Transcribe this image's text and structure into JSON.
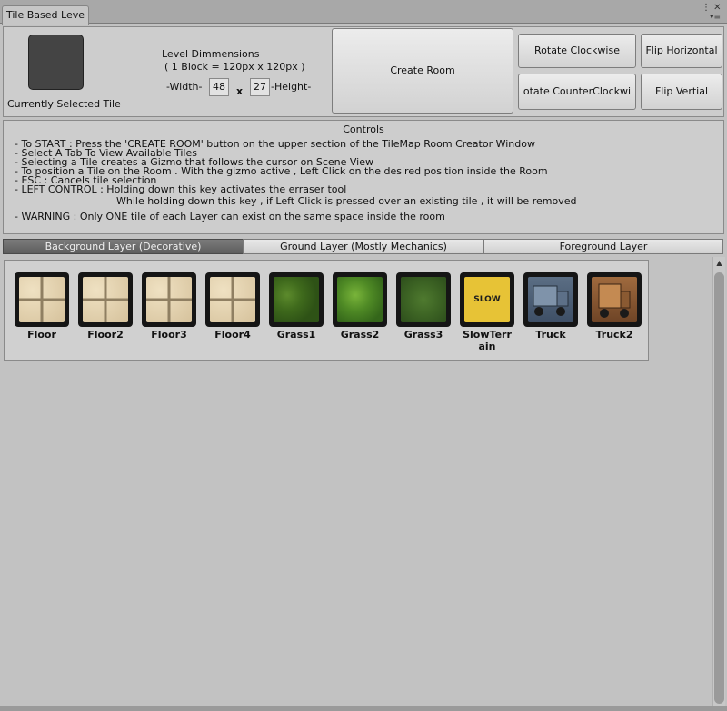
{
  "window": {
    "tab_title": "Tile Based Leve",
    "controls_glyphs": "⋮ ✕",
    "menu_glyph": "▾≡"
  },
  "top_panel": {
    "selected_tile_label": "Currently Selected Tile",
    "dimensions_title": "Level Dimmensions",
    "dimensions_subtitle": "( 1 Block = 120px x 120px )",
    "width_label": "-Width-",
    "width_value": "48",
    "times": "x",
    "height_value": "27",
    "height_label": "-Height-",
    "create_room": "Create Room",
    "rotate_cw": "Rotate Clockwise",
    "rotate_ccw": "otate CounterClockwi",
    "flip_h": "Flip Horizontal",
    "flip_v": "Flip Vertial"
  },
  "controls": {
    "title": "Controls",
    "lines": [
      "- To START : Press the 'CREATE ROOM' button on the upper section of the TileMap Room Creator Window",
      "- Select A Tab To View Available Tiles",
      "- Selecting a Tile creates a Gizmo that follows the cursor on Scene View",
      "- To position a Tile on the Room . With the gizmo active , Left Click on the desired position inside the Room",
      "- ESC : Cancels tile selection",
      "- LEFT CONTROL : Holding down this key activates the erraser tool",
      "While holding down this key , if Left Click is pressed over an existing tile , it will be removed",
      "- WARNING : Only ONE tile of each Layer can exist on the same space inside the room"
    ]
  },
  "layer_tabs": [
    {
      "label": "Background Layer (Decorative)",
      "active": true
    },
    {
      "label": "Ground Layer (Mostly Mechanics)",
      "active": false
    },
    {
      "label": "Foreground Layer",
      "active": false
    }
  ],
  "tiles": [
    {
      "name": "Floor",
      "icon": "floor-tile"
    },
    {
      "name": "Floor2",
      "icon": "floor-tile"
    },
    {
      "name": "Floor3",
      "icon": "floor-tile"
    },
    {
      "name": "Floor4",
      "icon": "floor-tile"
    },
    {
      "name": "Grass1",
      "icon": "grass-tile"
    },
    {
      "name": "Grass2",
      "icon": "grass-tile"
    },
    {
      "name": "Grass3",
      "icon": "grass-tile"
    },
    {
      "name": "SlowTerr",
      "name_line2": "ain",
      "icon": "slow-sign",
      "sign_text": "SLOW"
    },
    {
      "name": "Truck",
      "icon": "truck"
    },
    {
      "name": "Truck2",
      "icon": "truck"
    }
  ],
  "colors": {
    "active_tab": "#6a6a6a",
    "slow_yellow": "#e7c336",
    "tile_frame": "#151515"
  }
}
